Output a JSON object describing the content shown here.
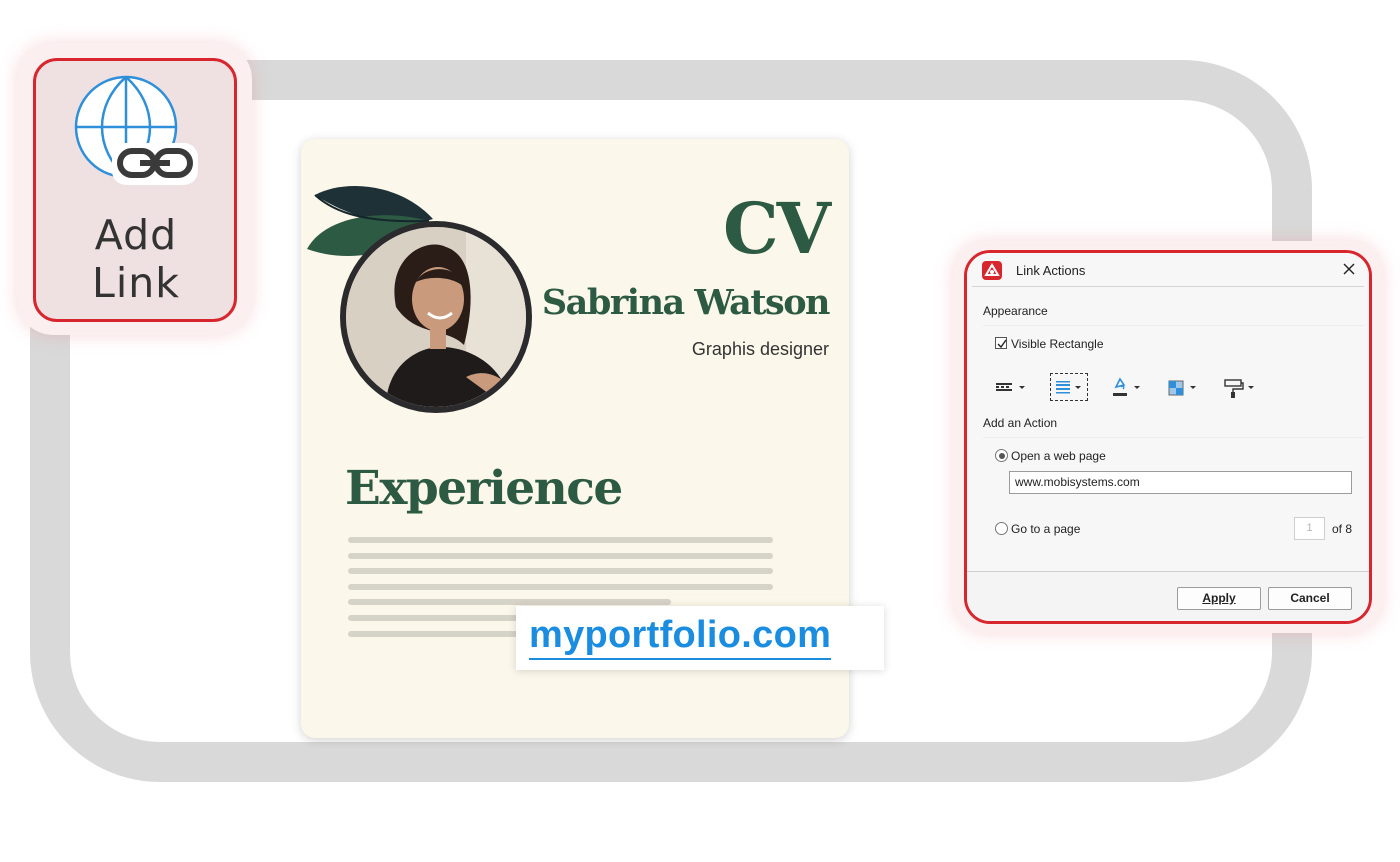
{
  "ribbon": {
    "add_link_label_line1": "Add",
    "add_link_label_line2": "Link",
    "icon": "globe-link-icon"
  },
  "cv": {
    "title": "CV",
    "name": "Sabrina Watson",
    "role": "Graphis designer",
    "section": "Experience",
    "colors": {
      "heading": "#2d5a43",
      "paper": "#fbf7ea"
    }
  },
  "link_badge": {
    "text": "myportfolio.com",
    "color": "#1a8de0"
  },
  "dialog": {
    "title": "Link Actions",
    "appearance_label": "Appearance",
    "visible_rectangle_label": "Visible Rectangle",
    "visible_rectangle_checked": true,
    "toolbar_icons": [
      "line-style-icon",
      "line-thickness-icon",
      "line-color-icon",
      "highlight-style-icon",
      "fill-color-icon"
    ],
    "add_action_label": "Add an Action",
    "open_web_page_label": "Open a web page",
    "open_web_page_selected": true,
    "url_value": "www.mobisystems.com",
    "go_to_page_label": "Go to a page",
    "page_placeholder": "1",
    "page_total": "of 8",
    "apply_label": "Apply",
    "cancel_label": "Cancel",
    "accent": "#d7262e"
  }
}
